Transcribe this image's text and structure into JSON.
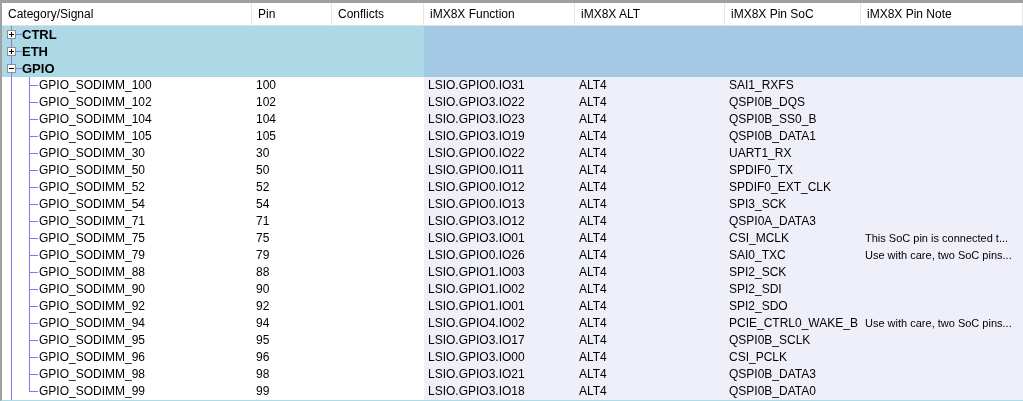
{
  "table": {
    "columns": [
      "Category/Signal",
      "Pin",
      "Conflicts",
      "iMX8X Function",
      "iMX8X ALT",
      "iMX8X Pin SoC",
      "iMX8X Pin Note"
    ],
    "categories": [
      {
        "name": "CTRL",
        "expanded": false
      },
      {
        "name": "ETH",
        "expanded": false
      },
      {
        "name": "GPIO",
        "expanded": true,
        "children": [
          {
            "signal": "GPIO_SODIMM_100",
            "pin": "100",
            "function": "LSIO.GPIO0.IO31",
            "alt": "ALT4",
            "soc": "SAI1_RXFS"
          },
          {
            "signal": "GPIO_SODIMM_102",
            "pin": "102",
            "function": "LSIO.GPIO3.IO22",
            "alt": "ALT4",
            "soc": "QSPI0B_DQS"
          },
          {
            "signal": "GPIO_SODIMM_104",
            "pin": "104",
            "function": "LSIO.GPIO3.IO23",
            "alt": "ALT4",
            "soc": "QSPI0B_SS0_B"
          },
          {
            "signal": "GPIO_SODIMM_105",
            "pin": "105",
            "function": "LSIO.GPIO3.IO19",
            "alt": "ALT4",
            "soc": "QSPI0B_DATA1"
          },
          {
            "signal": "GPIO_SODIMM_30",
            "pin": "30",
            "function": "LSIO.GPIO0.IO22",
            "alt": "ALT4",
            "soc": "UART1_RX"
          },
          {
            "signal": "GPIO_SODIMM_50",
            "pin": "50",
            "function": "LSIO.GPIO0.IO11",
            "alt": "ALT4",
            "soc": "SPDIF0_TX"
          },
          {
            "signal": "GPIO_SODIMM_52",
            "pin": "52",
            "function": "LSIO.GPIO0.IO12",
            "alt": "ALT4",
            "soc": "SPDIF0_EXT_CLK"
          },
          {
            "signal": "GPIO_SODIMM_54",
            "pin": "54",
            "function": "LSIO.GPIO0.IO13",
            "alt": "ALT4",
            "soc": "SPI3_SCK"
          },
          {
            "signal": "GPIO_SODIMM_71",
            "pin": "71",
            "function": "LSIO.GPIO3.IO12",
            "alt": "ALT4",
            "soc": "QSPI0A_DATA3"
          },
          {
            "signal": "GPIO_SODIMM_75",
            "pin": "75",
            "function": "LSIO.GPIO3.IO01",
            "alt": "ALT4",
            "soc": "CSI_MCLK",
            "note": "This SoC pin is connected t..."
          },
          {
            "signal": "GPIO_SODIMM_79",
            "pin": "79",
            "function": "LSIO.GPIO0.IO26",
            "alt": "ALT4",
            "soc": "SAI0_TXC",
            "note": "Use with care, two SoC pins..."
          },
          {
            "signal": "GPIO_SODIMM_88",
            "pin": "88",
            "function": "LSIO.GPIO1.IO03",
            "alt": "ALT4",
            "soc": "SPI2_SCK"
          },
          {
            "signal": "GPIO_SODIMM_90",
            "pin": "90",
            "function": "LSIO.GPIO1.IO02",
            "alt": "ALT4",
            "soc": "SPI2_SDI"
          },
          {
            "signal": "GPIO_SODIMM_92",
            "pin": "92",
            "function": "LSIO.GPIO1.IO01",
            "alt": "ALT4",
            "soc": "SPI2_SDO"
          },
          {
            "signal": "GPIO_SODIMM_94",
            "pin": "94",
            "function": "LSIO.GPIO4.IO02",
            "alt": "ALT4",
            "soc": "PCIE_CTRL0_WAKE_B",
            "note": "Use with care, two SoC pins..."
          },
          {
            "signal": "GPIO_SODIMM_95",
            "pin": "95",
            "function": "LSIO.GPIO3.IO17",
            "alt": "ALT4",
            "soc": "QSPI0B_SCLK"
          },
          {
            "signal": "GPIO_SODIMM_96",
            "pin": "96",
            "function": "LSIO.GPIO3.IO00",
            "alt": "ALT4",
            "soc": "CSI_PCLK"
          },
          {
            "signal": "GPIO_SODIMM_98",
            "pin": "98",
            "function": "LSIO.GPIO3.IO21",
            "alt": "ALT4",
            "soc": "QSPI0B_DATA3"
          },
          {
            "signal": "GPIO_SODIMM_99",
            "pin": "99",
            "function": "LSIO.GPIO3.IO18",
            "alt": "ALT4",
            "soc": "QSPI0B_DATA0"
          }
        ]
      }
    ]
  }
}
